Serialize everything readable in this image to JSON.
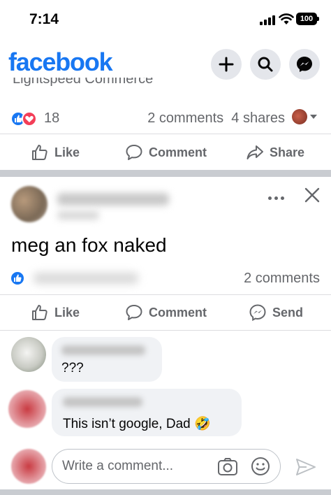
{
  "status_bar": {
    "time": "7:14",
    "battery": "100"
  },
  "header": {
    "logo": "facebook",
    "icons": [
      "plus-icon",
      "search-icon",
      "messenger-icon"
    ]
  },
  "previous_post": {
    "cut_text": "Lightspeed Commerce",
    "reaction_count": "18",
    "stats": "2 comments  4 shares",
    "actions": {
      "like": "Like",
      "comment": "Comment",
      "share": "Share"
    }
  },
  "post": {
    "text": "meg an fox naked",
    "comments_count": "2 comments",
    "actions": {
      "like": "Like",
      "comment": "Comment",
      "send": "Send"
    }
  },
  "comments": [
    {
      "text": "???"
    },
    {
      "text": "This isn’t google, Dad 🤣"
    }
  ],
  "composer": {
    "placeholder": "Write a comment..."
  },
  "colors": {
    "brand": "#1877f2",
    "love": "#f33e58",
    "muted": "#65676b",
    "bubble": "#f0f2f5"
  }
}
